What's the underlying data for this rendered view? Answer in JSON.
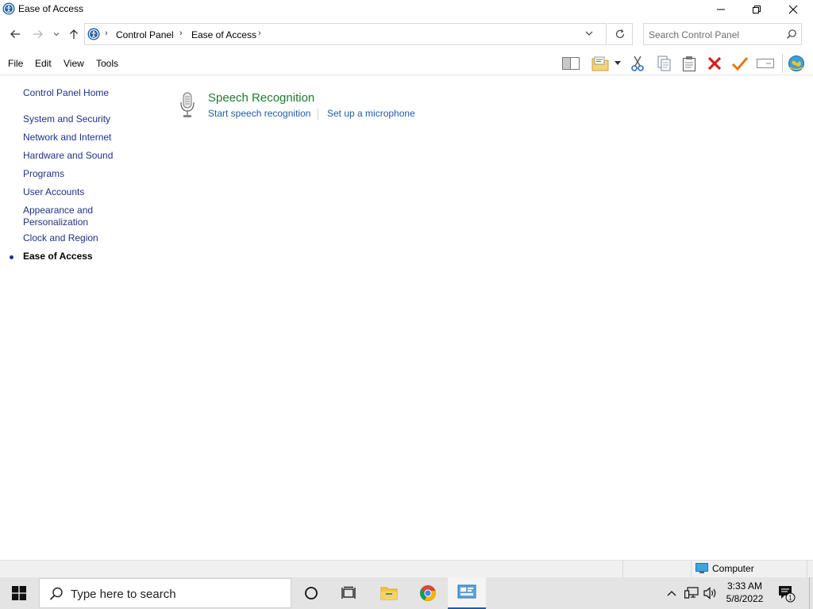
{
  "window": {
    "title": "Ease of Access",
    "controls": [
      "minimize",
      "maximize",
      "close"
    ]
  },
  "address": {
    "breadcrumbs": [
      "Control Panel",
      "Ease of Access"
    ],
    "search_placeholder": "Search Control Panel"
  },
  "menu": {
    "items": [
      "File",
      "Edit",
      "View",
      "Tools"
    ]
  },
  "toolbar": {
    "icons": [
      "preview-pane-icon",
      "new-folder-icon",
      "cut-icon",
      "copy-icon",
      "paste-icon",
      "delete-icon",
      "checkmark-icon",
      "rename-icon",
      "globe-icon"
    ]
  },
  "sidebar": {
    "items": [
      {
        "label": "Control Panel Home"
      },
      {
        "label": "System and Security"
      },
      {
        "label": "Network and Internet"
      },
      {
        "label": "Hardware and Sound"
      },
      {
        "label": "Programs"
      },
      {
        "label": "User Accounts"
      },
      {
        "label": "Appearance and"
      },
      {
        "label": "Personalization"
      },
      {
        "label": "Clock and Region"
      },
      {
        "label": "Ease of Access"
      }
    ],
    "current": "Ease of Access"
  },
  "main": {
    "section": {
      "title": "Speech Recognition",
      "icon": "microphone-icon",
      "links": [
        "Start speech recognition",
        "Set up a microphone"
      ]
    }
  },
  "statusbar": {
    "location": "Computer"
  },
  "taskbar": {
    "search_placeholder": "Type here to search",
    "time": "3:33 AM",
    "date": "5/8/2022",
    "notification_count": "1"
  },
  "colors": {
    "link": "#1e3287",
    "task_link": "#1e5ba8",
    "section_title": "#1e7a2e",
    "taskbar_bg": "#e4e4e4"
  }
}
